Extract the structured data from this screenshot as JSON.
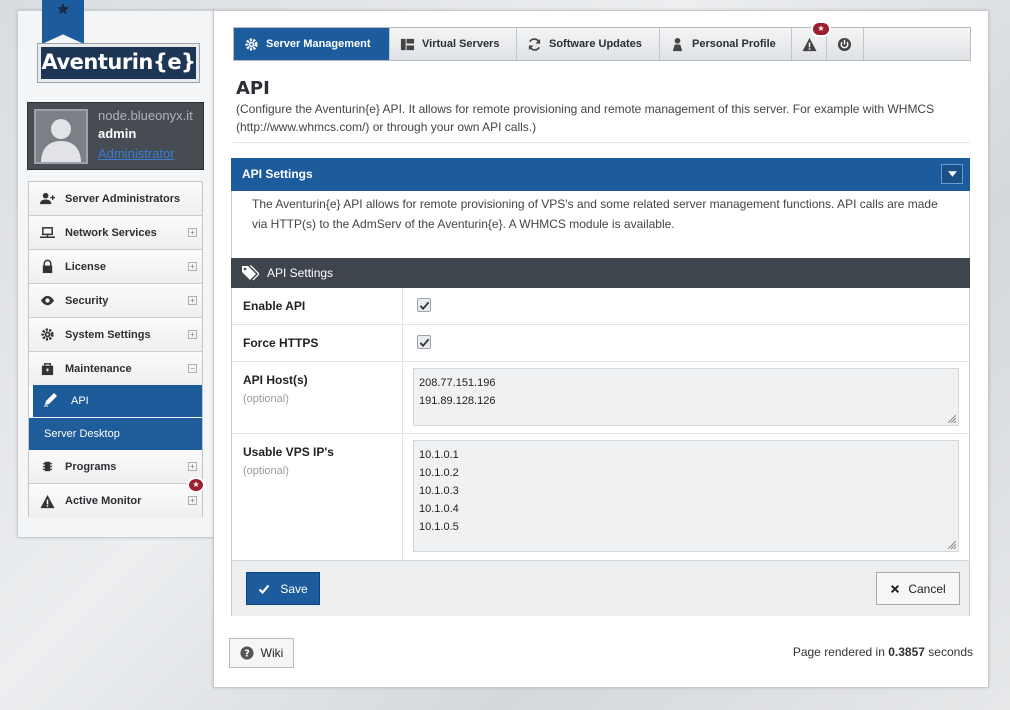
{
  "brand": {
    "logo_text": "Aventurin{e}"
  },
  "user": {
    "host": "node.blueonyx.it",
    "name": "admin",
    "role": "Administrator"
  },
  "sidebar": {
    "items": [
      {
        "label": "Server Administrators",
        "icon": "users-icon"
      },
      {
        "label": "Network Services",
        "icon": "network-icon"
      },
      {
        "label": "License",
        "icon": "lock-icon"
      },
      {
        "label": "Security",
        "icon": "eye-icon"
      },
      {
        "label": "System Settings",
        "icon": "gear-icon"
      },
      {
        "label": "Maintenance",
        "icon": "briefcase-icon"
      },
      {
        "label": "Programs",
        "icon": "chip-icon"
      },
      {
        "label": "Active Monitor",
        "icon": "warning-icon"
      }
    ],
    "sub_items": [
      {
        "label": "API",
        "icon": "pencil-icon"
      },
      {
        "label": "Server Desktop"
      }
    ],
    "expand_symbol": "+",
    "collapse_symbol": "−",
    "badge": "★"
  },
  "tabs": [
    {
      "label": "Server Management",
      "icon": "gear-icon",
      "active": true
    },
    {
      "label": "Virtual Servers",
      "icon": "grid-icon"
    },
    {
      "label": "Software Updates",
      "icon": "refresh-icon"
    },
    {
      "label": "Personal Profile",
      "icon": "person-icon"
    },
    {
      "label": "",
      "icon": "warning-icon"
    },
    {
      "label": "",
      "icon": "logout-icon"
    }
  ],
  "alert_badge": "★",
  "page": {
    "title": "API",
    "description": "(Configure the Aventurin{e} API. It allows for remote provisioning and remote management of this server. For example with WHMCS (http://www.whmcs.com/) or through your own API calls.)"
  },
  "box": {
    "header": "API Settings",
    "description": "The Aventurin{e} API allows for remote provisioning of VPS's and some related server management functions. API calls are made via HTTP(s) to the AdmServ of the Aventurin{e}. A WHMCS module is available.",
    "subheader": "API Settings"
  },
  "form": {
    "enable_api": {
      "label": "Enable API",
      "checked": true
    },
    "force_https": {
      "label": "Force HTTPS",
      "checked": true
    },
    "api_hosts": {
      "label": "API Host(s)",
      "optional": "(optional)",
      "lines": [
        "208.77.151.196",
        "191.89.128.126"
      ]
    },
    "usable_ips": {
      "label": "Usable VPS IP's",
      "optional": "(optional)",
      "lines": [
        "10.1.0.1",
        "10.1.0.2",
        "10.1.0.3",
        "10.1.0.4",
        "10.1.0.5"
      ]
    }
  },
  "buttons": {
    "save": "Save",
    "cancel": "Cancel",
    "wiki": "Wiki"
  },
  "footer": {
    "prefix": "Page rendered in",
    "time": "0.3857",
    "suffix": "seconds"
  },
  "colors": {
    "accent": "#1d5c9c",
    "badge": "#9b1f2e",
    "dark": "#3f454c"
  }
}
